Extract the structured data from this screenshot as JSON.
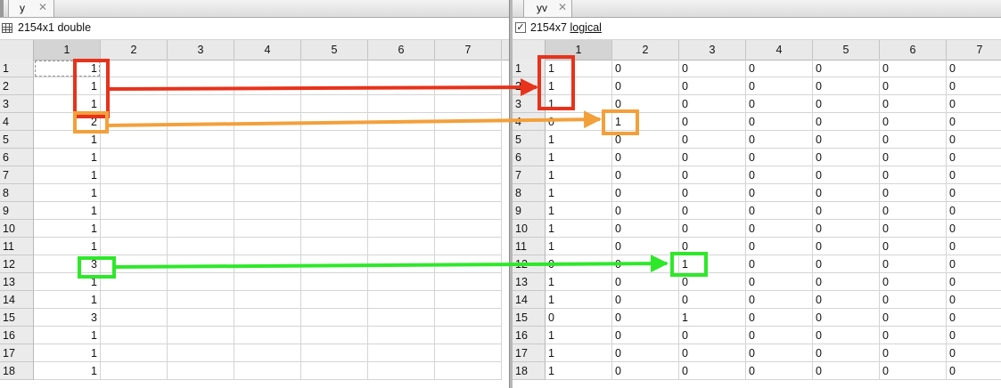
{
  "left": {
    "tab_label": "y",
    "close_glyph": "✕",
    "info": "2154x1 double",
    "columns": [
      "1",
      "2",
      "3",
      "4",
      "5",
      "6",
      "7"
    ],
    "rows": [
      "1",
      "2",
      "3",
      "4",
      "5",
      "6",
      "7",
      "8",
      "9",
      "10",
      "11",
      "12",
      "13",
      "14",
      "15",
      "16",
      "17",
      "18"
    ],
    "values": [
      "1",
      "1",
      "1",
      "2",
      "1",
      "1",
      "1",
      "1",
      "1",
      "1",
      "1",
      "3",
      "1",
      "1",
      "3",
      "1",
      "1",
      "1"
    ]
  },
  "right": {
    "tab_label": "yv",
    "close_glyph": "✕",
    "info_size": "2154x7",
    "info_type": "logical",
    "check_glyph": "✓",
    "columns": [
      "1",
      "2",
      "3",
      "4",
      "5",
      "6",
      "7"
    ],
    "rows": [
      "1",
      "2",
      "3",
      "4",
      "5",
      "6",
      "7",
      "8",
      "9",
      "10",
      "11",
      "12",
      "13",
      "14",
      "15",
      "16",
      "17",
      "18"
    ],
    "cells": [
      [
        "1",
        "0",
        "0",
        "0",
        "0",
        "0",
        "0"
      ],
      [
        "1",
        "0",
        "0",
        "0",
        "0",
        "0",
        "0"
      ],
      [
        "1",
        "0",
        "0",
        "0",
        "0",
        "0",
        "0"
      ],
      [
        "0",
        "1",
        "0",
        "0",
        "0",
        "0",
        "0"
      ],
      [
        "1",
        "0",
        "0",
        "0",
        "0",
        "0",
        "0"
      ],
      [
        "1",
        "0",
        "0",
        "0",
        "0",
        "0",
        "0"
      ],
      [
        "1",
        "0",
        "0",
        "0",
        "0",
        "0",
        "0"
      ],
      [
        "1",
        "0",
        "0",
        "0",
        "0",
        "0",
        "0"
      ],
      [
        "1",
        "0",
        "0",
        "0",
        "0",
        "0",
        "0"
      ],
      [
        "1",
        "0",
        "0",
        "0",
        "0",
        "0",
        "0"
      ],
      [
        "1",
        "0",
        "0",
        "0",
        "0",
        "0",
        "0"
      ],
      [
        "0",
        "0",
        "1",
        "0",
        "0",
        "0",
        "0"
      ],
      [
        "1",
        "0",
        "0",
        "0",
        "0",
        "0",
        "0"
      ],
      [
        "1",
        "0",
        "0",
        "0",
        "0",
        "0",
        "0"
      ],
      [
        "0",
        "0",
        "1",
        "0",
        "0",
        "0",
        "0"
      ],
      [
        "1",
        "0",
        "0",
        "0",
        "0",
        "0",
        "0"
      ],
      [
        "1",
        "0",
        "0",
        "0",
        "0",
        "0",
        "0"
      ],
      [
        "1",
        "0",
        "0",
        "0",
        "0",
        "0",
        "0"
      ]
    ]
  },
  "annotations": {
    "red": "#e8321b",
    "orange": "#f3a03b",
    "green": "#2ee82a"
  }
}
